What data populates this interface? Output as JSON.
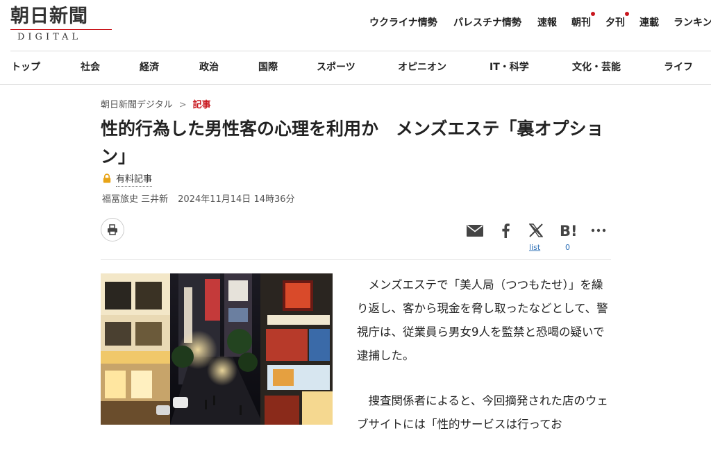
{
  "header": {
    "logo_main": "朝日新聞",
    "logo_sub": "DIGITAL",
    "topnav": [
      {
        "label": "ウクライナ情勢",
        "dot": false
      },
      {
        "label": "パレスチナ情勢",
        "dot": false
      },
      {
        "label": "速報",
        "dot": false
      },
      {
        "label": "朝刊",
        "dot": true
      },
      {
        "label": "夕刊",
        "dot": true
      },
      {
        "label": "連載",
        "dot": false
      },
      {
        "label": "ランキン",
        "dot": false
      }
    ],
    "categories": [
      "トップ",
      "社会",
      "経済",
      "政治",
      "国際",
      "スポーツ",
      "オピニオン",
      "IT・科学",
      "文化・芸能",
      "ライフ"
    ]
  },
  "breadcrumb": {
    "home": "朝日新聞デジタル",
    "separator": ">",
    "current": "記事"
  },
  "article": {
    "title": "性的行為した男性客の心理を利用か　メンズエステ「裏オプション」",
    "paid_label": "有料記事",
    "authors": "福冨旅史 三井新",
    "datetime": "2024年11月14日 14時36分",
    "paragraphs": [
      "メンズエステで「美人局（つつもたせ）」を繰り返し、客から現金を脅し取ったなどとして、警視庁は、従業員ら男女9人を監禁と恐喝の疑いで逮捕した。",
      "捜査関係者によると、今回摘発された店のウェブサイトには「性的サービスは行ってお"
    ]
  },
  "share": {
    "list_label": "list",
    "hatena_count": "0"
  },
  "icons": [
    "lock-icon",
    "print-icon",
    "mail-icon",
    "facebook-icon",
    "x-icon",
    "hatena-bookmark-icon",
    "more-icon"
  ],
  "colors": {
    "brand_red": "#c8161d",
    "link_blue": "#2a6db5",
    "lock_gold": "#e8a417"
  }
}
